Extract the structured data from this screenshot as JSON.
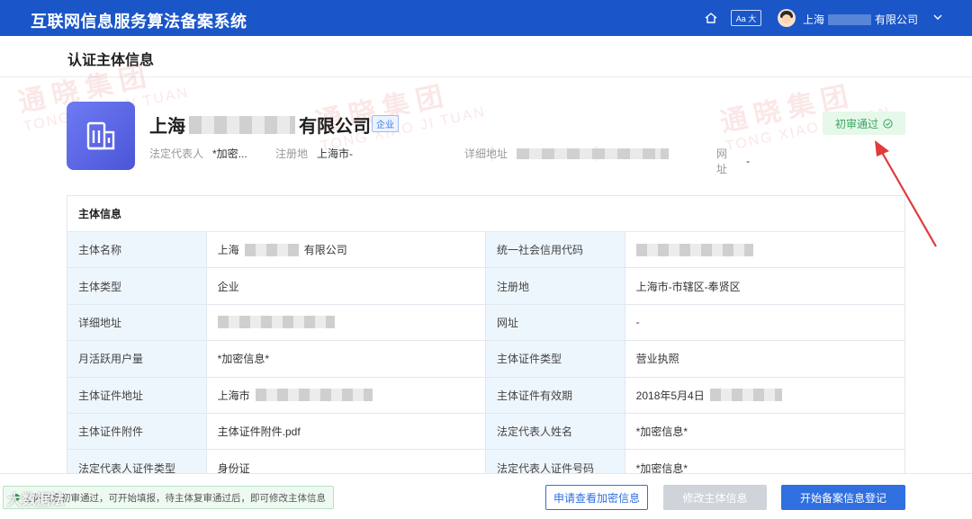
{
  "header": {
    "app_title": "互联网信息服务算法备案系统",
    "font_toggle": "Aa 大",
    "user_prefix": "上海",
    "user_suffix": "有限公司"
  },
  "page": {
    "title": "认证主体信息"
  },
  "entity": {
    "name_prefix": "上海",
    "name_suffix": "有限公司",
    "tag": "企业",
    "status": "初审通过",
    "meta": [
      {
        "label": "法定代表人",
        "value": "*加密..."
      },
      {
        "label": "注册地",
        "value": "上海市-"
      },
      {
        "label": "详细地址",
        "value": ""
      },
      {
        "label": "网址",
        "value": "-"
      }
    ]
  },
  "table": {
    "title": "主体信息",
    "rows": [
      {
        "l1": "主体名称",
        "v1": "上海",
        "v1b": "有限公司",
        "l2": "统一社会信用代码",
        "v2": ""
      },
      {
        "l1": "主体类型",
        "v1": "企业",
        "v1b": "",
        "l2": "注册地",
        "v2": "上海市-市辖区-奉贤区"
      },
      {
        "l1": "详细地址",
        "v1": "",
        "v1b": "",
        "l2": "网址",
        "v2": "-"
      },
      {
        "l1": "月活跃用户量",
        "v1": "*加密信息*",
        "v1b": "",
        "l2": "主体证件类型",
        "v2": "营业执照"
      },
      {
        "l1": "主体证件地址",
        "v1": "上海市",
        "v1b": "",
        "l2": "主体证件有效期",
        "v2": "2018年5月4日"
      },
      {
        "l1": "主体证件附件",
        "v1": "主体证件附件.pdf",
        "v1b": "",
        "l2": "法定代表人姓名",
        "v2": "*加密信息*"
      },
      {
        "l1": "法定代表人证件类型",
        "v1": "身份证",
        "v1b": "",
        "l2": "法定代表人证件号码",
        "v2": "*加密信息*"
      }
    ]
  },
  "watermark": {
    "cn": "通晓集团",
    "en": "TONG XIAO JI TUAN"
  },
  "bottom": {
    "notice": "主体信息初审通过，可开始填报，待主体复审通过后，即可修改主体信息",
    "btn_view_encrypted": "申请查看加密信息",
    "btn_edit": "修改主体信息",
    "btn_start": "开始备案信息登记",
    "footer_mark": "大数据法"
  },
  "colors": {
    "primary": "#2f6fe0",
    "topbar": "#1a56c8",
    "success": "#3aa560"
  }
}
